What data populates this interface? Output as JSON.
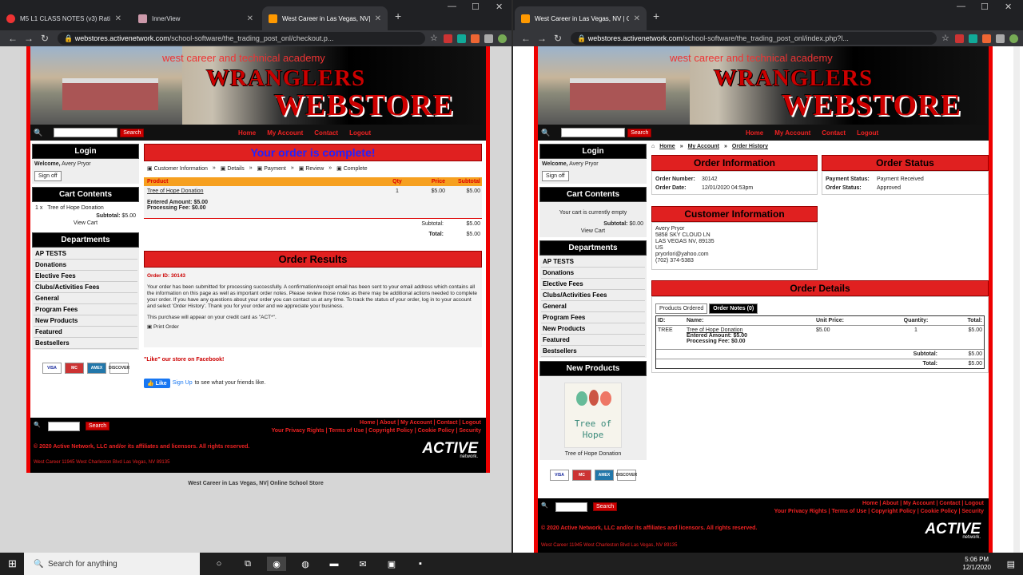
{
  "left_window": {
    "tabs": [
      {
        "title": "M5 L1 CLASS NOTES (v3) Ration"
      },
      {
        "title": "InnerView"
      },
      {
        "title": "West Career in Las Vegas, NV| On"
      }
    ],
    "url_domain": "webstores.activenetwork.com",
    "url_path": "/school-software/the_trading_post_onl/checkout.p..."
  },
  "right_window": {
    "tabs": [
      {
        "title": "West Career in Las Vegas, NV | On"
      }
    ],
    "url_domain": "webstores.activenetwork.com",
    "url_path": "/school-software/the_trading_post_onl/index.php?l..."
  },
  "banner": {
    "subtitle": "west career and technical academy",
    "title1": "WRANGLERS",
    "title2": "WEBSTORE"
  },
  "topnav": {
    "search_btn": "Search",
    "links": [
      "Home",
      "My Account",
      "Contact",
      "Logout"
    ]
  },
  "sidebar": {
    "login_header": "Login",
    "welcome_label": "Welcome,",
    "user": "Avery Pryor",
    "signoff": "Sign off",
    "cart_header": "Cart Contents",
    "departments_header": "Departments",
    "departments": [
      "AP TESTS",
      "Donations",
      "Elective Fees",
      "Clubs/Activities Fees",
      "General",
      "Program Fees",
      "New Products",
      "Featured",
      "Bestsellers"
    ],
    "cards": [
      "VISA",
      "MC",
      "AMEX",
      "DISCOVER"
    ]
  },
  "left_page": {
    "cart_item_qty": "1 x",
    "cart_item_name": "Tree of Hope Donation",
    "cart_subtotal_label": "Subtotal:",
    "cart_subtotal": "$5.00",
    "view_cart": "View Cart",
    "complete_title": "Your order is complete!",
    "steps": [
      "Customer Information",
      "Details",
      "Payment",
      "Review",
      "Complete"
    ],
    "table_headers": [
      "Product",
      "Qty",
      "Price",
      "Subtotal"
    ],
    "item_name": "Tree of Hope Donation",
    "item_qty": "1",
    "item_price": "$5.00",
    "item_subtotal": "$5.00",
    "entered_amount": "Entered Amount: $5.00",
    "processing_fee": "Processing Fee: $0.00",
    "subtotal_label": "Subtotal:",
    "subtotal": "$5.00",
    "total_label": "Total:",
    "total": "$5.00",
    "results_title": "Order Results",
    "order_id": "Order ID:  30143",
    "results_text": "Your order has been submitted for processing successfully. A confirmation/receipt email has been sent to your email address which contains all the information on this page as well as important order notes. Please review those notes as there may be additional actions needed to complete your order. If you have any questions about your order you can contact us at any time. To track the status of your order, log in to your account and select 'Order History'. Thank you for your order and we appreciate your business.",
    "cc_note": "This purchase will appear on your credit card as \"ACT*\".",
    "print_order": "Print Order",
    "facebook_text": "\"Like\" our store on Facebook!",
    "like_btn": "Like",
    "signup_text": "Sign Up",
    "signup_rest": "to see what your friends like.",
    "below_footer": "West Career in Las Vegas, NV| Online School Store"
  },
  "right_page": {
    "breadcrumb": [
      "Home",
      "My Account",
      "Order History"
    ],
    "cart_empty": "Your cart is currently empty",
    "cart_subtotal_label": "Subtotal:",
    "cart_subtotal": "$0.00",
    "view_cart": "View Cart",
    "order_info_title": "Order Information",
    "order_number_label": "Order Number:",
    "order_number": "30142",
    "order_date_label": "Order Date:",
    "order_date": "12/01/2020 04:53pm",
    "order_status_title": "Order Status",
    "payment_status_label": "Payment Status:",
    "payment_status": "Payment Received",
    "order_status_label": "Order Status:",
    "order_status": "Approved",
    "customer_title": "Customer Information",
    "customer_lines": [
      "Avery Pryor",
      "5858 SKY CLOUD LN",
      "LAS VEGAS NV, 89135",
      "US",
      "pryorlori@yahoo.com",
      "(702) 374-5383"
    ],
    "order_details_title": "Order Details",
    "tab_products": "Products Ordered",
    "tab_notes": "Order Notes (0)",
    "cols": [
      "ID:",
      "Name:",
      "Unit Price:",
      "Quantity:",
      "Total:"
    ],
    "row_id": "TREE",
    "row_name": "Tree of Hope Donation",
    "row_entered": "Entered Amount: $5.00",
    "row_fee": "Processing Fee: $0.00",
    "row_price": "$5.00",
    "row_qty": "1",
    "row_total": "$5.00",
    "subtotal_label": "Subtotal:",
    "subtotal": "$5.00",
    "total_label": "Total:",
    "total": "$5.00",
    "new_products_header": "New Products",
    "product_image_text1": "Tree of",
    "product_image_text2": "Hope",
    "product_caption": "Tree of Hope Donation"
  },
  "footer": {
    "links1": "Home | About | My Account | Contact | Logout",
    "links2": "Your Privacy Rights | Terms of Use | Copyright Policy | Cookie Policy | Security",
    "copyright": "© 2020 Active Network, LLC and/or its affiliates and licensors. All rights reserved.",
    "address": "West Career 11945 West Charleston Blvd Las Vegas, NV 89135",
    "logo": "ACTIVE",
    "logo_sub": "network."
  },
  "taskbar": {
    "search": "Search for anything",
    "time": "5:06 PM",
    "date": "12/1/2020"
  }
}
